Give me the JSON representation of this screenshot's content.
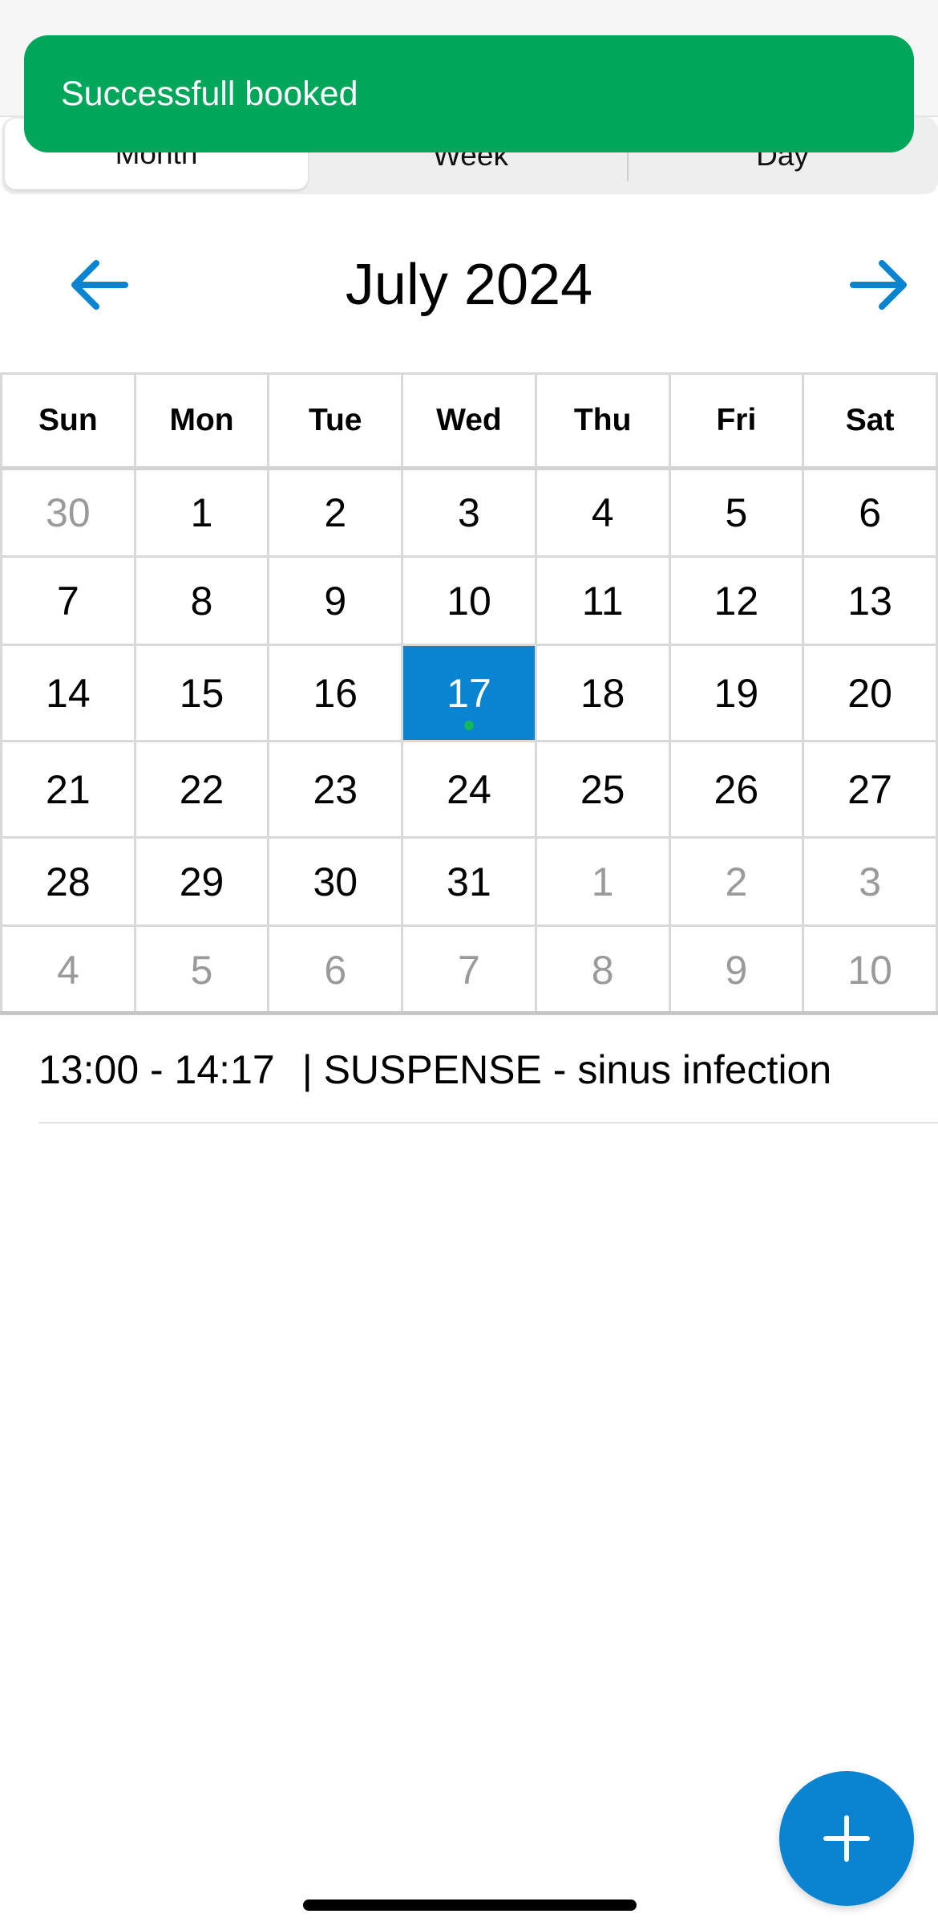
{
  "toast": {
    "message": "Successfull booked",
    "color": "#00a65a"
  },
  "view_tabs": [
    {
      "label": "Month",
      "selected": true
    },
    {
      "label": "Week",
      "selected": false
    },
    {
      "label": "Day",
      "selected": false
    }
  ],
  "header": {
    "title": "July 2024",
    "prev_icon": "arrow-left-icon",
    "next_icon": "arrow-right-icon",
    "accent": "#0a84d0"
  },
  "calendar": {
    "weekdays": [
      "Sun",
      "Mon",
      "Tue",
      "Wed",
      "Thu",
      "Fri",
      "Sat"
    ],
    "weeks": [
      [
        {
          "d": "30",
          "muted": true
        },
        {
          "d": "1"
        },
        {
          "d": "2"
        },
        {
          "d": "3"
        },
        {
          "d": "4"
        },
        {
          "d": "5"
        },
        {
          "d": "6"
        }
      ],
      [
        {
          "d": "7"
        },
        {
          "d": "8"
        },
        {
          "d": "9"
        },
        {
          "d": "10"
        },
        {
          "d": "11"
        },
        {
          "d": "12"
        },
        {
          "d": "13"
        }
      ],
      [
        {
          "d": "14"
        },
        {
          "d": "15"
        },
        {
          "d": "16"
        },
        {
          "d": "17",
          "selected": true,
          "has_event": true
        },
        {
          "d": "18"
        },
        {
          "d": "19"
        },
        {
          "d": "20"
        }
      ],
      [
        {
          "d": "21"
        },
        {
          "d": "22"
        },
        {
          "d": "23"
        },
        {
          "d": "24"
        },
        {
          "d": "25"
        },
        {
          "d": "26"
        },
        {
          "d": "27"
        }
      ],
      [
        {
          "d": "28"
        },
        {
          "d": "29"
        },
        {
          "d": "30"
        },
        {
          "d": "31"
        },
        {
          "d": "1",
          "muted": true
        },
        {
          "d": "2",
          "muted": true
        },
        {
          "d": "3",
          "muted": true
        }
      ],
      [
        {
          "d": "4",
          "muted": true
        },
        {
          "d": "5",
          "muted": true
        },
        {
          "d": "6",
          "muted": true
        },
        {
          "d": "7",
          "muted": true
        },
        {
          "d": "8",
          "muted": true
        },
        {
          "d": "9",
          "muted": true
        },
        {
          "d": "10",
          "muted": true
        }
      ]
    ],
    "selected_color": "#0a84d0",
    "event_dot_color": "#14b85a"
  },
  "events": [
    {
      "time": "13:00 - 14:17",
      "title": "| SUSPENSE - sinus infection"
    }
  ],
  "fab": {
    "icon": "plus-icon"
  }
}
